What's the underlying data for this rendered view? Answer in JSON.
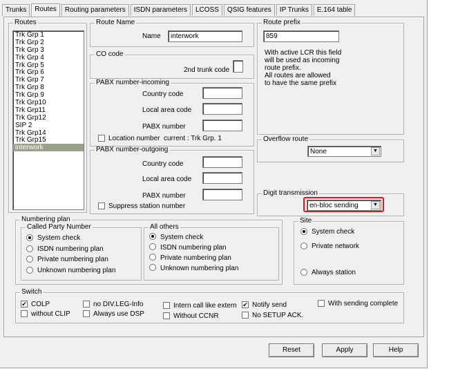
{
  "tabs": [
    "Trunks",
    "Routes",
    "Routing parameters",
    "ISDN parameters",
    "LCOSS",
    "QSIG features",
    "IP Trunks",
    "E.164 table"
  ],
  "routes": {
    "legend": "Routes",
    "items": [
      "Trk Grp 1",
      "Trk Grp 2",
      "Trk Grp 3",
      "Trk Grp 4",
      "Trk Grp 5",
      "Trk Grp 6",
      "Trk Grp 7",
      "Trk Grp 8",
      "Trk Grp 9",
      "Trk Grp10",
      "Trk Grp11",
      "Trk Grp12",
      "SIP 2",
      "Trk Grp14",
      "Trk Grp15",
      "interwork"
    ],
    "selected": "interwork"
  },
  "route_name": {
    "legend": "Route Name",
    "label": "Name",
    "value": "interwork"
  },
  "co_code": {
    "legend": "CO code",
    "label": "2nd trunk code",
    "value": ""
  },
  "pabx_incoming": {
    "legend": "PABX number-incoming",
    "country_label": "Country code",
    "area_label": "Local area code",
    "pabx_label": "PABX number",
    "location_label": "Location number",
    "current_label": "current : Trk Grp. 1"
  },
  "pabx_outgoing": {
    "legend": "PABX number-outgoing",
    "country_label": "Country code",
    "area_label": "Local area code",
    "pabx_label": "PABX number",
    "suppress_label": "Suppress station number"
  },
  "route_prefix": {
    "legend": "Route prefix",
    "value": "859",
    "note": [
      "With active LCR this field",
      "will be used as incoming",
      "route prefix.",
      "All routes are allowed",
      "to have the same prefix"
    ]
  },
  "overflow": {
    "legend": "Overflow route",
    "value": "None"
  },
  "digit": {
    "legend": "Digit transmission",
    "value": "en-bloc sending",
    "highlight_color": "#e8141c"
  },
  "numbering": {
    "legend": "Numbering plan",
    "called_legend": "Called Party Number",
    "called_options": [
      "System check",
      "ISDN numbering plan",
      "Private numbering plan",
      "Unknown numbering plan"
    ],
    "others_legend": "All others",
    "others_options": [
      "System check",
      "ISDN numbering plan",
      "Private numbering plan",
      "Unknown numbering plan"
    ]
  },
  "site": {
    "legend": "Site",
    "options": [
      "System check",
      "Private network",
      "Always station"
    ]
  },
  "switch": {
    "legend": "Switch",
    "items": {
      "colp": {
        "label": "COLP",
        "checked": true
      },
      "without_clip": {
        "label": "without CLIP",
        "checked": false
      },
      "no_div": {
        "label": "no DIV.LEG-Info",
        "checked": false
      },
      "always_dsp": {
        "label": "Always use DSP",
        "checked": false
      },
      "intern_call": {
        "label": "Intern call like extern",
        "checked": false
      },
      "without_ccnr": {
        "label": "Without CCNR",
        "checked": false
      },
      "notify_send": {
        "label": "Notify send",
        "checked": true
      },
      "no_setup": {
        "label": "No SETUP ACK.",
        "checked": false
      },
      "sending_complete": {
        "label": "With sending complete",
        "checked": false
      }
    }
  },
  "buttons": {
    "reset": "Reset",
    "apply": "Apply",
    "help": "Help"
  }
}
